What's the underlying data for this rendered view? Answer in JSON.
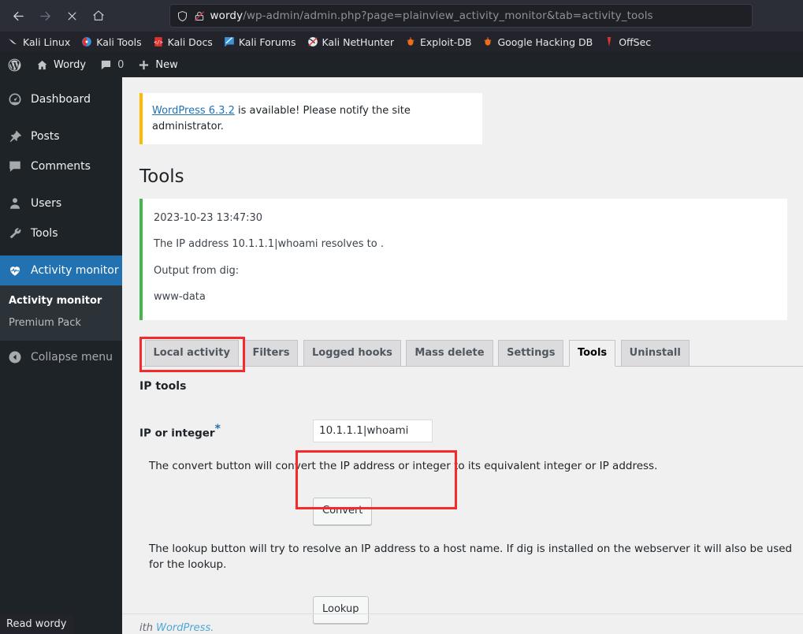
{
  "browser": {
    "nav": {
      "back": "back-arrow",
      "forward": "forward-arrow",
      "stop": "stop-x",
      "home": "home"
    },
    "url": {
      "host": "wordy",
      "path": "/wp-admin/admin.php?page=plainview_activity_monitor&tab=activity_tools",
      "full": "wordy/wp-admin/admin.php?page=plainview_activity_monitor&tab=activity_tools",
      "shield_icon": "shield-icon",
      "lock_icon": "lock-slashed-icon"
    },
    "bookmarks": [
      {
        "label": "Kali Linux",
        "icon": "kali-dragon-icon"
      },
      {
        "label": "Kali Tools",
        "icon": "kali-tools-icon"
      },
      {
        "label": "Kali Docs",
        "icon": "kali-docs-icon"
      },
      {
        "label": "Kali Forums",
        "icon": "kali-forums-icon"
      },
      {
        "label": "Kali NetHunter",
        "icon": "kali-nethunter-icon"
      },
      {
        "label": "Exploit-DB",
        "icon": "exploit-db-icon"
      },
      {
        "label": "Google Hacking DB",
        "icon": "google-hacking-db-icon"
      },
      {
        "label": "OffSec",
        "icon": "offsec-icon"
      }
    ],
    "status_text": "Read wordy"
  },
  "adminbar": {
    "logo": "wordpress-logo-icon",
    "site_name": "Wordy",
    "comments_count": "0",
    "new_label": "New"
  },
  "sidebar": {
    "items": [
      {
        "label": "Dashboard",
        "icon": "dashboard-icon",
        "current": false
      },
      {
        "label": "Posts",
        "icon": "pin-icon",
        "current": false
      },
      {
        "label": "Comments",
        "icon": "comment-icon",
        "current": false
      },
      {
        "label": "Users",
        "icon": "user-icon",
        "current": false
      },
      {
        "label": "Tools",
        "icon": "wrench-icon",
        "current": false
      },
      {
        "label": "Activity monitor",
        "icon": "heartbeat-icon",
        "current": true
      }
    ],
    "submenu": [
      {
        "label": "Activity monitor",
        "current": true
      },
      {
        "label": "Premium Pack",
        "current": false
      }
    ],
    "collapse_label": "Collapse menu",
    "collapse_icon": "collapse-arrow-icon"
  },
  "notice": {
    "link_text": "WordPress 6.3.2",
    "rest_text": " is available! Please notify the site administrator.",
    "accent_color": "#ffb900"
  },
  "page": {
    "title": "Tools"
  },
  "result": {
    "timestamp": "2023-10-23 13:47:30",
    "resolve_line": "The IP address 10.1.1.1|whoami resolves to .",
    "dig_label": "Output from dig:",
    "dig_output": "www-data",
    "accent_color": "#46b450"
  },
  "tabs": [
    {
      "label": "Local activity",
      "active": false
    },
    {
      "label": "Filters",
      "active": false
    },
    {
      "label": "Logged hooks",
      "active": false
    },
    {
      "label": "Mass delete",
      "active": false
    },
    {
      "label": "Settings",
      "active": false
    },
    {
      "label": "Tools",
      "active": true
    },
    {
      "label": "Uninstall",
      "active": false
    }
  ],
  "iptools": {
    "section_title": "IP tools",
    "field_label": "IP or integer",
    "required_marker": "*",
    "input_value": "10.1.1.1|whoami",
    "input_placeholder": "",
    "convert_description": "The convert button will convert the IP address or integer to its equivalent integer or IP address.",
    "convert_button": "Convert",
    "lookup_description": "The lookup button will try to resolve an IP address to a host name. If dig is installed on the webserver it will also be used for the lookup.",
    "lookup_button": "Lookup"
  },
  "footer": {
    "text_tail": "ith ",
    "link": "WordPress.",
    "full": "Thank you for creating with WordPress."
  },
  "annotations": {
    "highlight_color": "#f52a2a",
    "output_box": "dig-output-highlight",
    "input_box": "ip-input-highlight"
  }
}
